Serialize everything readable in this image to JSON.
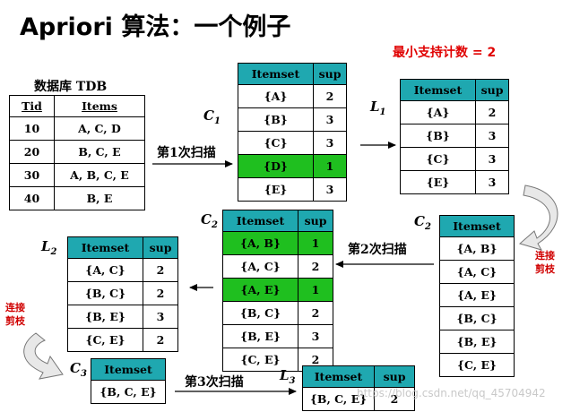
{
  "title": "Apriori 算法：一个例子",
  "min_support": "最小支持计数 = 2",
  "db": {
    "caption": "数据库 TDB",
    "headers": [
      "Tid",
      "Items"
    ],
    "rows": [
      [
        "10",
        "A, C, D"
      ],
      [
        "20",
        "B, C, E"
      ],
      [
        "30",
        "A, B, C, E"
      ],
      [
        "40",
        "B, E"
      ]
    ]
  },
  "set_labels": {
    "c1": {
      "letter": "C",
      "sub": "1"
    },
    "l1": {
      "letter": "L",
      "sub": "1"
    },
    "c2_right": {
      "letter": "C",
      "sub": "2"
    },
    "c2_mid": {
      "letter": "C",
      "sub": "2"
    },
    "l2": {
      "letter": "L",
      "sub": "2"
    },
    "c3": {
      "letter": "C",
      "sub": "3"
    },
    "l3": {
      "letter": "L",
      "sub": "3"
    }
  },
  "scans": {
    "scan1": "第1次扫描",
    "scan2": "第2次扫描",
    "scan3": "第3次扫描"
  },
  "notes": {
    "join_prune_right": [
      "连接",
      "剪枝"
    ],
    "join_prune_left": [
      "连接",
      "剪枝"
    ]
  },
  "headers": {
    "itemset": "Itemset",
    "sup": "sup"
  },
  "c1": [
    {
      "itemset": "{A}",
      "sup": "2"
    },
    {
      "itemset": "{B}",
      "sup": "3"
    },
    {
      "itemset": "{C}",
      "sup": "3"
    },
    {
      "itemset": "{D}",
      "sup": "1"
    },
    {
      "itemset": "{E}",
      "sup": "3"
    }
  ],
  "l1": [
    {
      "itemset": "{A}",
      "sup": "2"
    },
    {
      "itemset": "{B}",
      "sup": "3"
    },
    {
      "itemset": "{C}",
      "sup": "3"
    },
    {
      "itemset": "{E}",
      "sup": "3"
    }
  ],
  "c2_candidates": [
    "{A, B}",
    "{A, C}",
    "{A, E}",
    "{B, C}",
    "{B, E}",
    "{C, E}"
  ],
  "c2_counted": [
    {
      "itemset": "{A, B}",
      "sup": "1"
    },
    {
      "itemset": "{A, C}",
      "sup": "2"
    },
    {
      "itemset": "{A, E}",
      "sup": "1"
    },
    {
      "itemset": "{B, C}",
      "sup": "2"
    },
    {
      "itemset": "{B, E}",
      "sup": "3"
    },
    {
      "itemset": "{C, E}",
      "sup": "2"
    }
  ],
  "l2": [
    {
      "itemset": "{A, C}",
      "sup": "2"
    },
    {
      "itemset": "{B, C}",
      "sup": "2"
    },
    {
      "itemset": "{B, E}",
      "sup": "3"
    },
    {
      "itemset": "{C, E}",
      "sup": "2"
    }
  ],
  "c3": [
    "{B, C, E}"
  ],
  "l3": [
    {
      "itemset": "{B, C, E}",
      "sup": "2"
    }
  ],
  "watermark": "https://blog.csdn.net/qq_45704942",
  "colors": {
    "header": "#1fa8b0",
    "highlight": "#1fbf1f",
    "note_red": "#d00000"
  }
}
